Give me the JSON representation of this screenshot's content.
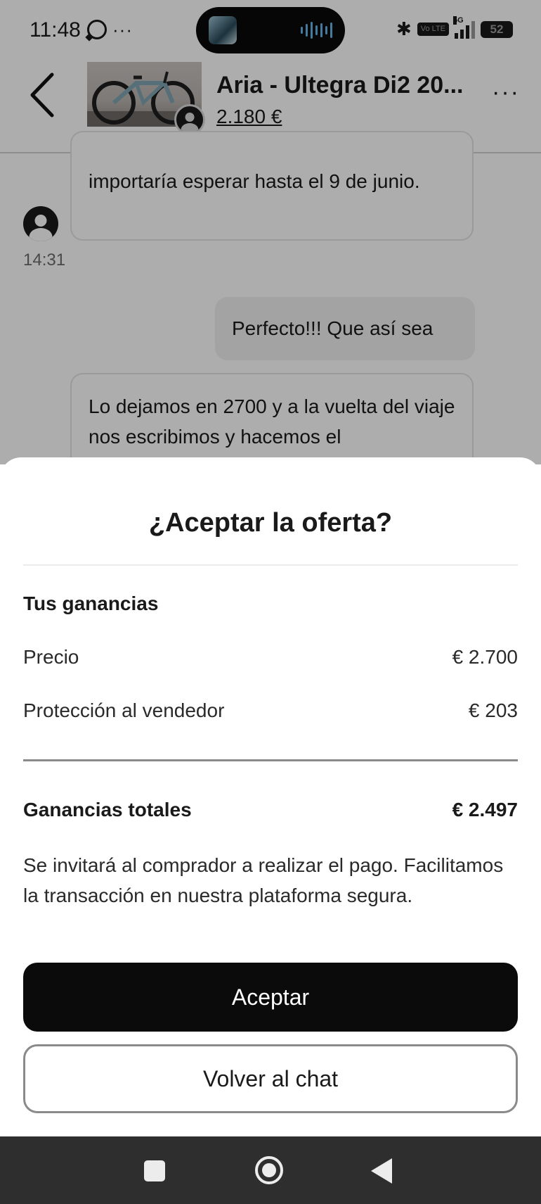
{
  "status_bar": {
    "time": "11:48",
    "more": "···",
    "battery": "52",
    "network": "5G",
    "volte": "Vo LTE"
  },
  "header": {
    "product_title": "Aria - Ultegra Di2 20...",
    "product_price": "2.180 €",
    "more": "···"
  },
  "chat": {
    "messages": [
      {
        "direction": "received",
        "text": "importaría esperar hasta el 9 de junio."
      },
      {
        "direction": "sent",
        "text": "Perfecto!!! Que así sea"
      },
      {
        "direction": "received",
        "text": "Lo dejamos en 2700 y a la vuelta del viaje nos escribimos y hacemos el"
      }
    ],
    "timestamp": "14:31"
  },
  "offer_sheet": {
    "title": "¿Aceptar la oferta?",
    "section_title": "Tus ganancias",
    "rows": [
      {
        "label": "Precio",
        "value": "€ 2.700"
      },
      {
        "label": "Protección al vendedor",
        "value": "€ 203"
      }
    ],
    "total": {
      "label": "Ganancias totales",
      "value": "€ 2.497"
    },
    "note": "Se invitará al comprador a realizar el pago. Facilitamos la transacción en nuestra plataforma segura.",
    "accept_label": "Aceptar",
    "back_label": "Volver al chat"
  },
  "colors": {
    "primary_button": "#0b0b0b",
    "overlay": "rgba(0,0,0,0.32)",
    "nav_bar": "#2e2e2e"
  }
}
